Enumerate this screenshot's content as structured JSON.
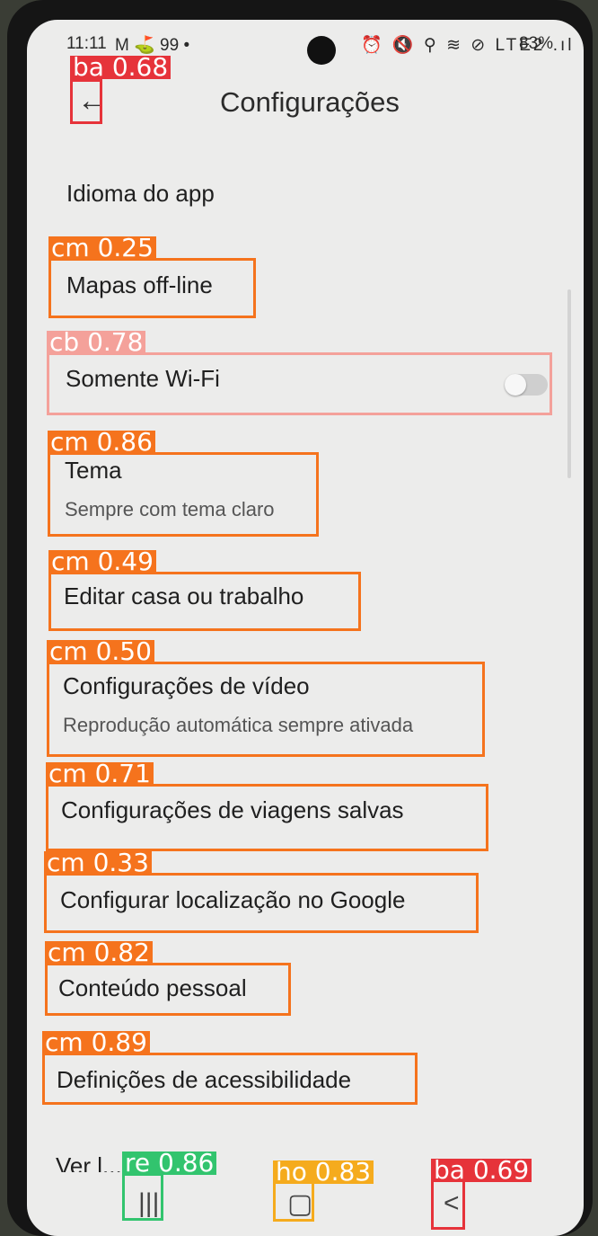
{
  "status_bar": {
    "time": "11:11",
    "left_icons": "M ⛳ 99 •",
    "right_icons": "⏰ 🔇 ⚲ ≋ ⊘ LTE2 .ıl",
    "battery": "83%"
  },
  "header": {
    "title": "Configurações",
    "back_icon": "arrow-left-icon"
  },
  "settings": {
    "idioma": "Idioma do app",
    "mapas_offline": "Mapas off-line",
    "somente_wifi": "Somente Wi-Fi",
    "somente_wifi_on": false,
    "tema": "Tema",
    "tema_sub": "Sempre com tema claro",
    "editar_casa": "Editar casa ou trabalho",
    "config_video": "Configurações de vídeo",
    "config_video_sub": "Reprodução automática sempre ativada",
    "config_viagens": "Configurações de viagens salvas",
    "config_localizacao": "Configurar localização no Google",
    "conteudo_pessoal": "Conteúdo pessoal",
    "acessibilidade": "Definições de acessibilidade",
    "next_partial": "Ver l... mais"
  },
  "navbar": {
    "recents_icon": "recents-icon",
    "home_icon": "home-icon",
    "back_icon": "back-chevron-icon"
  },
  "detections": [
    {
      "tag": "ba 0.68"
    },
    {
      "tag": "cm 0.25"
    },
    {
      "tag": "cb 0.78"
    },
    {
      "tag": "cm 0.86"
    },
    {
      "tag": "cm 0.49"
    },
    {
      "tag": "cm 0.50"
    },
    {
      "tag": "cm 0.71"
    },
    {
      "tag": "cm 0.33"
    },
    {
      "tag": "cm 0.82"
    },
    {
      "tag": "cm 0.89"
    },
    {
      "tag": "re 0.86"
    },
    {
      "tag": "ho 0.83"
    },
    {
      "tag": "ba 0.69"
    }
  ],
  "colors": {
    "cm": "#f5731d",
    "ba": "#e6333a",
    "cb": "#f4a19a",
    "re": "#32c46e",
    "ho": "#f5ab1d"
  }
}
